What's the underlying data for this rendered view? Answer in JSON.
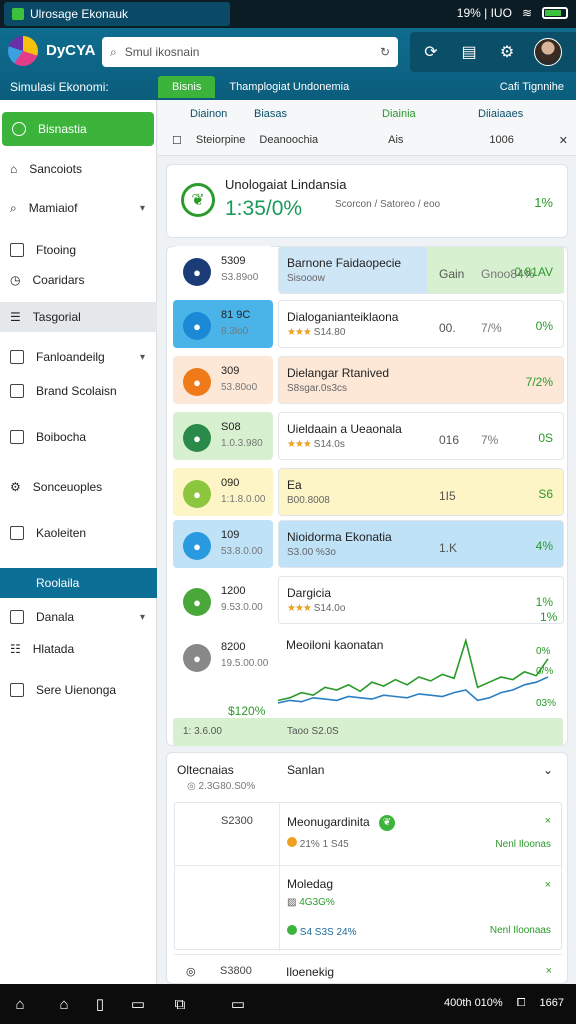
{
  "statusbar": {
    "tab_label": "Ulrosage Ekonauk",
    "right_text": "19% | IUO",
    "battery_icon": "battery-icon"
  },
  "header": {
    "app_name": "DyCYA",
    "search_placeholder": "Smul ikosnain",
    "subtitle": "Simulasi Ekonomi:"
  },
  "tabs": [
    {
      "label": "Bisnis"
    },
    {
      "label": "Thamplogiat Undonemia"
    },
    {
      "label": "Cafi Tignnihe"
    }
  ],
  "sidebar": {
    "items": [
      {
        "label": "Bisnastia",
        "icon": "search-icon"
      },
      {
        "label": "Sancoiots",
        "icon": "home-icon"
      },
      {
        "label": "Mamiaiof",
        "icon": "search-icon"
      },
      {
        "label": "Ftooing",
        "icon": "box-icon"
      },
      {
        "label": "Coaridars",
        "icon": "clock-icon"
      },
      {
        "label": "Tasgorial",
        "icon": "list-icon"
      },
      {
        "label": "Fanloandeilg",
        "icon": "box-icon"
      },
      {
        "label": "Brand Scolaisn",
        "icon": "box-icon"
      },
      {
        "label": "Boibocha",
        "icon": "box-icon"
      },
      {
        "label": "Sonceuoples",
        "icon": "gear-icon"
      },
      {
        "label": "Kaoleiten",
        "icon": "box-icon"
      },
      {
        "label": "Roolaila",
        "icon": "none"
      },
      {
        "label": "Danala",
        "icon": "calendar-icon"
      },
      {
        "label": "Hlatada",
        "icon": "list-icon"
      },
      {
        "label": "Sere Uienonga",
        "icon": "box-icon"
      }
    ]
  },
  "filter": {
    "headers": [
      "Diainon",
      "Biasas",
      "Diainia",
      "Diiaiaaes"
    ],
    "row": [
      "Steiorpine",
      "Deanoochia",
      "Ais",
      "1006"
    ]
  },
  "summary": {
    "title": "Unologaiat Lindansia",
    "value": "1:35/0%",
    "mini": "Scorcon / Satoreo / eoo",
    "pct": "1%"
  },
  "tiles": [
    {
      "v1": "5309",
      "v2": "S3.89o0",
      "bg": "#fff",
      "ic": "#1c3c78"
    },
    {
      "v1": "81 9C",
      "v2": "8.3lo0",
      "bg": "#4ab4e8",
      "ic": "#1a8ad6"
    },
    {
      "v1": "309",
      "v2": "53.80o0",
      "bg": "#fde8d8",
      "ic": "#f07a1a"
    },
    {
      "v1": "S08",
      "v2": "1.0.3.980",
      "bg": "#d7f0cf",
      "ic": "#2a8a4a"
    },
    {
      "v1": "090",
      "v2": "1:1.8.0.00",
      "bg": "#fdf5c6",
      "ic": "#8cc63f"
    },
    {
      "v1": "109",
      "v2": "53.8.0.00",
      "bg": "#bfe2f7",
      "ic": "#2a9ae0"
    },
    {
      "v1": "1200",
      "v2": "9.53.0.00",
      "bg": "#fff",
      "ic": "#4aa83a"
    },
    {
      "v1": "8200",
      "v2": "19.5.00.00",
      "bg": "#fff",
      "ic": "#888"
    }
  ],
  "rows": [
    {
      "name": "Barnone Faidaopecie",
      "stat": "Sisooow",
      "c1": "Gain",
      "c2": "Gnoo84%",
      "c3": "0.81AV",
      "bg": "#cfe6f7"
    },
    {
      "name": "Dialoganianteiklaona",
      "stat": "S14.80",
      "c1": "00.",
      "c2": "7/%",
      "c3": "0%",
      "bg": "#fff",
      "stars": "★★★"
    },
    {
      "name": "Dielangar Rtanived",
      "stat": "S8sgar.0s3cs",
      "c1": "",
      "c2": "",
      "c3": "7/2%",
      "bg": "#fde8d8"
    },
    {
      "name": "Uieldaain a Ueaonala",
      "stat": "S14.0s",
      "c1": "016",
      "c2": "7%",
      "c3": "0S",
      "bg": "#fff",
      "stars": "★★★"
    },
    {
      "name": "Ea",
      "stat": "B00.8008",
      "c1": "1I5",
      "c2": "",
      "c3": "S6",
      "bg": "#fdf5c6"
    },
    {
      "name": "Nioidorma Ekonatia",
      "stat": "S3.00 %3o",
      "c1": "1.K",
      "c2": "",
      "c3": "4%",
      "bg": "#bfe2f7"
    },
    {
      "name": "Dargicia",
      "stat": "S14.0o",
      "c1": "",
      "c2": "",
      "c3": "1%",
      "bg": "#fff",
      "stars": "★★★"
    },
    {
      "name": "Meoiloni kaonatan",
      "stat": "",
      "c1": "",
      "c2": "",
      "c3": "0%",
      "bg": "#fff"
    }
  ],
  "chart_data": {
    "type": "line",
    "series": [
      {
        "values": [
          12,
          14,
          18,
          16,
          22,
          20,
          24,
          19,
          26,
          23,
          28,
          24,
          30,
          27,
          32,
          29,
          58,
          22,
          26,
          30,
          28,
          34,
          31,
          44
        ]
      },
      {
        "values": [
          10,
          12,
          11,
          14,
          13,
          12,
          15,
          14,
          13,
          16,
          15,
          14,
          17,
          16,
          15,
          18,
          20,
          12,
          14,
          18,
          20,
          24,
          26,
          30
        ]
      }
    ],
    "ylabel_left": "$120%",
    "tag_right_1": "0%",
    "tag_right_2": "0/%",
    "tag_right_3": "03%",
    "footer_left": "1: 3.6.00",
    "footer_right": "Taoo S2.0S"
  },
  "lower": {
    "head_left": "Oltecnaias",
    "head_left_sub": "2.3G80.S0%",
    "head_right": "Sanlan",
    "rows": [
      {
        "left": "S2300",
        "name": "Meonugardinita",
        "stat": "21% 1 S45",
        "action": "Nenl Iloonas"
      },
      {
        "left": "",
        "name": "Moledag",
        "stat": "4G3G%",
        "action": "",
        "badge": "S4 S3S 24%",
        "action2": "Nenl Iloonaas"
      },
      {
        "left": "S3800",
        "name": "Iloenekig",
        "stat": "",
        "action": ""
      }
    ]
  },
  "bottom": {
    "right": [
      "400th 010%",
      "1667"
    ]
  },
  "colors": {
    "primary": "#0b6f96",
    "accent": "#3cb43c"
  }
}
